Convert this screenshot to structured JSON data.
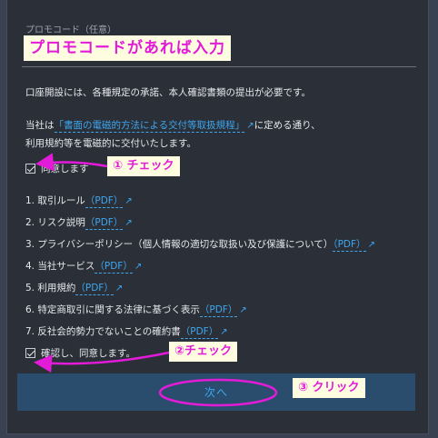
{
  "promo": {
    "label": "プロモコード（任意）",
    "hint": "プロモコードがあれば入力"
  },
  "notice": "口座開設には、各種規定の承諾、本人確認書類の提出が必要です。",
  "terms": {
    "line1_before": "当社は",
    "line1_link": "「書面の電磁的方法による交付等取扱規程」",
    "line1_after": "に定める通り、",
    "line2": "利用規約等を電磁的に交付いたします。"
  },
  "agree1": {
    "label": "同意します",
    "checked": true,
    "annotation": "① チェック"
  },
  "documents": [
    {
      "label": "1. 取引ルール",
      "link": "（PDF）"
    },
    {
      "label": "2. リスク説明",
      "link": "（PDF）"
    },
    {
      "label": "3. プライバシーポリシー（個人情報の適切な取扱い及び保護について）",
      "link": "（PDF）"
    },
    {
      "label": "4. 当社サービス",
      "link": "（PDF）"
    },
    {
      "label": "5. 利用規約",
      "link": "（PDF）"
    },
    {
      "label": "6. 特定商取引に関する法律に基づく表示",
      "link": "（PDF）"
    },
    {
      "label": "7. 反社会的勢力でないことの確約書",
      "link": "（PDF）"
    }
  ],
  "agree2": {
    "label": "確認し、同意します。",
    "checked": true,
    "annotation": "②チェック"
  },
  "next": {
    "label": "次へ",
    "annotation": "③ クリック"
  },
  "icons": {
    "external": "↗"
  },
  "colors": {
    "annotation": "#e21bd8",
    "link": "#3da7f0",
    "button_bg": "#2a4d6e"
  }
}
